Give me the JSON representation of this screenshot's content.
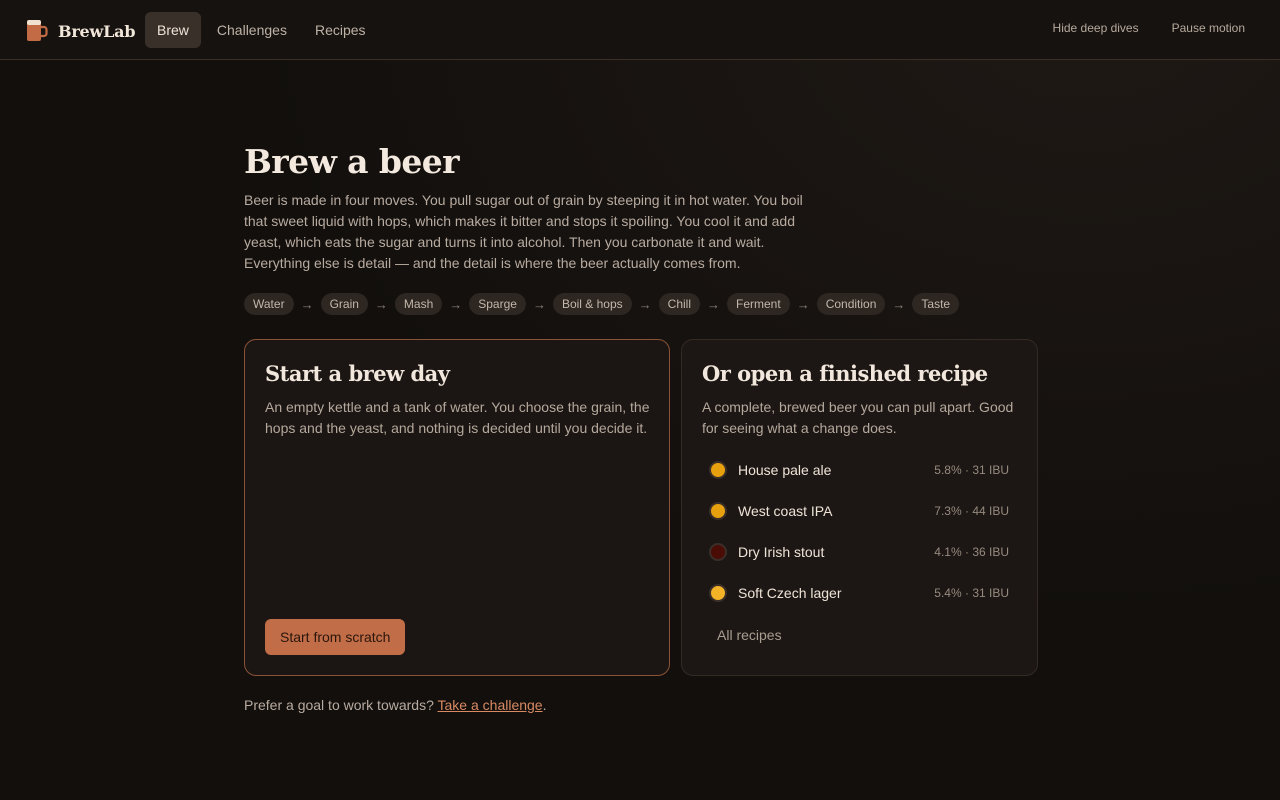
{
  "colors": {
    "accent": "#c16e48",
    "link": "#d88a63",
    "background": "#120f0d",
    "card": "#1b1613"
  },
  "app": {
    "name": "BrewLab",
    "logo_icon": "beer-mug-icon"
  },
  "nav": {
    "tabs": [
      {
        "label": "Brew",
        "active": true
      },
      {
        "label": "Challenges",
        "active": false
      },
      {
        "label": "Recipes",
        "active": false
      }
    ]
  },
  "header_actions": {
    "hide_deep_dives": "Hide deep dives",
    "pause_motion": "Pause motion"
  },
  "main": {
    "title": "Brew a beer",
    "intro": "Beer is made in four moves. You pull sugar out of grain by steeping it in hot water. You boil that sweet liquid with hops, which makes it bitter and stops it spoiling. You cool it and add yeast, which eats the sugar and turns it into alcohol. Then you carbonate it and wait. Everything else is detail — and the detail is where the beer actually comes from.",
    "steps": [
      "Water",
      "Grain",
      "Mash",
      "Sparge",
      "Boil & hops",
      "Chill",
      "Ferment",
      "Condition",
      "Taste"
    ],
    "step_separator": "→"
  },
  "start_card": {
    "title": "Start a brew day",
    "description": "An empty kettle and a tank of water. You choose the grain, the hops and the yeast, and nothing is decided until you decide it.",
    "button_label": "Start from scratch"
  },
  "recipe_card": {
    "title": "Or open a finished recipe",
    "description": "A complete, brewed beer you can pull apart. Good for seeing what a change does.",
    "recipes": [
      {
        "name": "House pale ale",
        "stats": "5.8% · 31 IBU",
        "color": "#e8a10e"
      },
      {
        "name": "West coast IPA",
        "stats": "7.3% · 44 IBU",
        "color": "#e8a10e"
      },
      {
        "name": "Dry Irish stout",
        "stats": "4.1% · 36 IBU",
        "color": "#4a0d05"
      },
      {
        "name": "Soft Czech lager",
        "stats": "5.4% · 31 IBU",
        "color": "#f4b227"
      }
    ],
    "all_recipes_label": "All recipes"
  },
  "footnote": {
    "prefix": "Prefer a goal to work towards? ",
    "link": "Take a challenge",
    "suffix": "."
  }
}
